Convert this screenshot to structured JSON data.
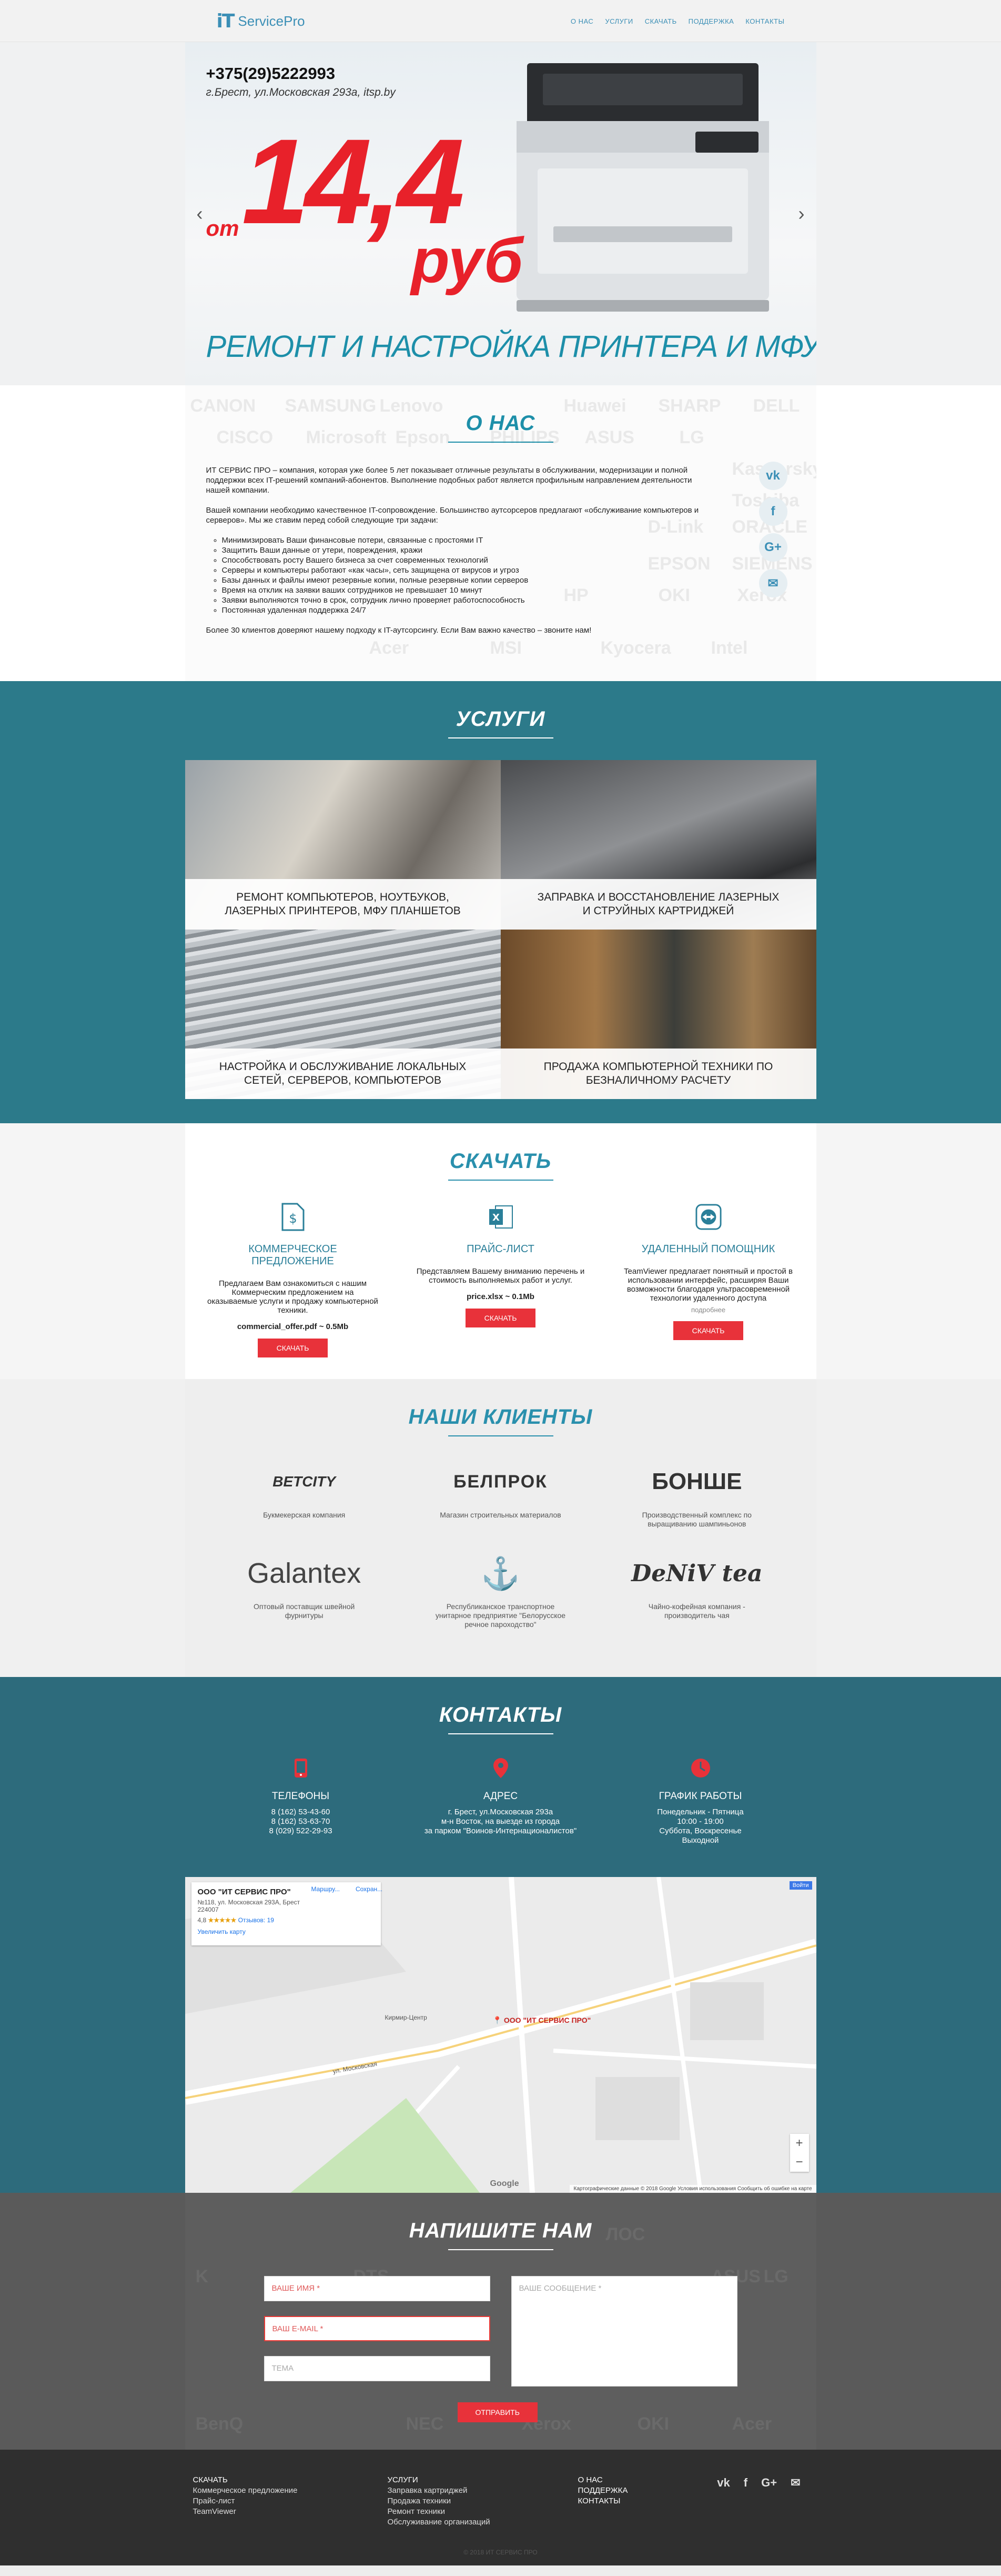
{
  "header": {
    "logo_mark": "iT",
    "logo_text": "ServicePro",
    "nav": [
      "О НАС",
      "УСЛУГИ",
      "СКАЧАТЬ",
      "ПОДДЕРЖКА",
      "КОНТАКТЫ"
    ]
  },
  "hero": {
    "phone": "+375(29)5222993",
    "address": "г.Брест, ул.Московская 293а, itsp.by",
    "price_from": "от",
    "price": "14,4",
    "price_unit": "руб",
    "title": "РЕМОНТ И НАСТРОЙКА ПРИНТЕРА И МФУ",
    "prev": "‹",
    "next": "›"
  },
  "about": {
    "title": "О НАС",
    "p1": "ИТ СЕРВИС ПРО – компания, которая уже более 5 лет показывает отличные результаты в обслуживании, модернизации и полной поддержки всех IT-решений компаний-абонентов. Выполнение подобных работ является профильным направлением деятельности нашей компании.",
    "p2": "Вашей компании необходимо качественное IT-сопровождение. Большинство аутсорсеров предлагают «обслуживание компьютеров и серверов». Мы же ставим перед собой следующие три задачи:",
    "list": [
      "Минимизировать Ваши финансовые потери, связанные с простоями IT",
      "Защитить Ваши данные от утери, повреждения, кражи",
      "Способствовать росту Вашего бизнеса за счет современных технологий",
      "Серверы и компьютеры работают «как часы», сеть защищена от вирусов и угроз",
      "Базы данных и файлы имеют резервные копии, полные резервные копии серверов",
      "Время на отклик на заявки ваших сотрудников не превышает 10 минут",
      "Заявки выполняются точно в срок, сотрудник лично проверяет работоспособность",
      "Постоянная удаленная поддержка 24/7"
    ],
    "p3": "Более 30 клиентов доверяют нашему подходу к IT-аутсорсингу. Если Вам важно качество – звоните нам!",
    "bg_brands": [
      "CANON",
      "SAMSUNG",
      "Lenovo",
      "Huawei",
      "SHARP",
      "DELL",
      "CISCO",
      "Microsoft",
      "Epson",
      "PHILIPS",
      "ASUS",
      "LG",
      "Kaspersky",
      "Toshiba",
      "D-Link",
      "ORACLE",
      "EPSON",
      "SIEMENS",
      "Xerox",
      "HP",
      "OKI",
      "Acer",
      "MSI",
      "Kyocera",
      "Intel"
    ],
    "social": [
      "vk",
      "f",
      "G+",
      "✉"
    ]
  },
  "services": {
    "title": "УСЛУГИ",
    "items": [
      "РЕМОНТ КОМПЬЮТЕРОВ, НОУТБУКОВ, ЛАЗЕРНЫХ ПРИНТЕРОВ, МФУ ПЛАНШЕТОВ",
      "ЗАПРАВКА И ВОССТАНОВЛЕНИЕ ЛАЗЕРНЫХ И СТРУЙНЫХ КАРТРИДЖЕЙ",
      "НАСТРОЙКА И ОБСЛУЖИВАНИЕ ЛОКАЛЬНЫХ СЕТЕЙ, СЕРВЕРОВ, КОМПЬЮТЕРОВ",
      "ПРОДАЖА КОМПЬЮТЕРНОЙ ТЕХНИКИ ПО БЕЗНАЛИЧНОМУ РАСЧЕТУ"
    ]
  },
  "downloads": {
    "title": "СКАЧАТЬ",
    "items": [
      {
        "icon": "dollar-document-icon",
        "head": "КОММЕРЧЕСКОЕ ПРЕДЛОЖЕНИЕ",
        "desc": "Предлагаем Вам ознакомиться с нашим Коммерческим предложением на оказываемые услуги и продажу компьютерной техники.",
        "file": "commercial_offer.pdf ~ 0.5Mb",
        "button": "СКАЧАТЬ"
      },
      {
        "icon": "excel-icon",
        "head": "ПРАЙС-ЛИСТ",
        "desc": "Представляем Вашему вниманию перечень и стоимость выполняемых работ и услуг.",
        "file": "price.xlsx ~ 0.1Mb",
        "button": "СКАЧАТЬ"
      },
      {
        "icon": "teamviewer-icon",
        "head": "УДАЛЕННЫЙ ПОМОЩНИК",
        "desc": "TeamViewer предлагает понятный и простой в использовании интерфейс, расширяя Ваши возможности благодаря ультрасовременной технологии удаленного доступа",
        "sub": "подробнее",
        "button": "СКАЧАТЬ"
      }
    ]
  },
  "clients": {
    "title": "НАШИ КЛИЕНТЫ",
    "items": [
      {
        "logo": "BETCITY",
        "desc": "Букмекерская компания"
      },
      {
        "logo": "БЕЛПРОК",
        "desc": "Магазин строительных материалов"
      },
      {
        "logo": "БОНШЕ",
        "desc": "Производственный комплекс по выращиванию шампиньонов"
      },
      {
        "logo": "Galantex",
        "desc": "Оптовый поставщик швейной фурнитуры"
      },
      {
        "logo": "⚓",
        "desc": "Республиканское транспортное унитарное предприятие \"Белорусское речное пароходство\""
      },
      {
        "logo": "DeNiV tea",
        "desc": "Чайно-кофейная компания - производитель чая"
      }
    ]
  },
  "contacts": {
    "title": "КОНТАКТЫ",
    "cols": [
      {
        "head": "ТЕЛЕФОНЫ",
        "lines": [
          "8 (162) 53-43-60",
          "8 (162) 53-63-70",
          "8 (029) 522-29-93"
        ]
      },
      {
        "head": "АДРЕС",
        "lines": [
          "г. Брест, ул.Московская 293а",
          "м-н Восток, на выезде из города",
          "за парком \"Воинов-Интернационалистов\""
        ]
      },
      {
        "head": "ГРАФИК РАБОТЫ",
        "lines": [
          "Понедельник - Пятница",
          "10:00 - 19:00",
          "Суббота, Воскресенье",
          "Выходной"
        ]
      }
    ],
    "map": {
      "card_title": "ООО \"ИТ СЕРВИС ПРО\"",
      "card_addr": "№118, ул. Московская 293А, Брест 224007",
      "rating": "4,8",
      "reviews": "Отзывов: 19",
      "enlarge": "Увеличить карту",
      "route": "Маршру...",
      "save": "Сохран...",
      "pin_label": "ООО \"ИТ СЕРВИС ПРО\"",
      "street": "ул. Московская",
      "kiev": "Кирмир-Центр",
      "zoom_in": "+",
      "zoom_out": "−",
      "google": "Google",
      "footer": "Картографические данные © 2018 Google   Условия использования   Сообщить об ошибке на карте",
      "open_big": "Войти"
    }
  },
  "write": {
    "title": "НАПИШИТЕ НАМ",
    "name_placeholder": "ВАШЕ ИМЯ *",
    "email_placeholder": "ВАШ E-MAIL *",
    "theme_placeholder": "ТЕМА",
    "message_placeholder": "ВАШЕ СООБЩЕНИЕ *",
    "button": "ОТПРАВИТЬ",
    "bg_brands": [
      "ЛОС",
      "K",
      "DTS",
      "ASUS",
      "BenQ",
      "NEC",
      "Xerox",
      "OKI",
      "Acer",
      "LG"
    ]
  },
  "footer": {
    "col1": {
      "head": "СКАЧАТЬ",
      "items": [
        "Коммерческое предложение",
        "Прайс-лист",
        "TeamViewer"
      ]
    },
    "col2": {
      "head": "УСЛУГИ",
      "items": [
        "Заправка картриджей",
        "Продажа техники",
        "Ремонт техники",
        "Обслуживание организаций"
      ]
    },
    "col3": {
      "items": [
        "О НАС",
        "ПОДДЕРЖКА",
        "КОНТАКТЫ"
      ]
    },
    "social": [
      "vk",
      "f",
      "G+",
      "✉"
    ],
    "copyright": "© 2018 ИТ СЕРВИС ПРО"
  }
}
